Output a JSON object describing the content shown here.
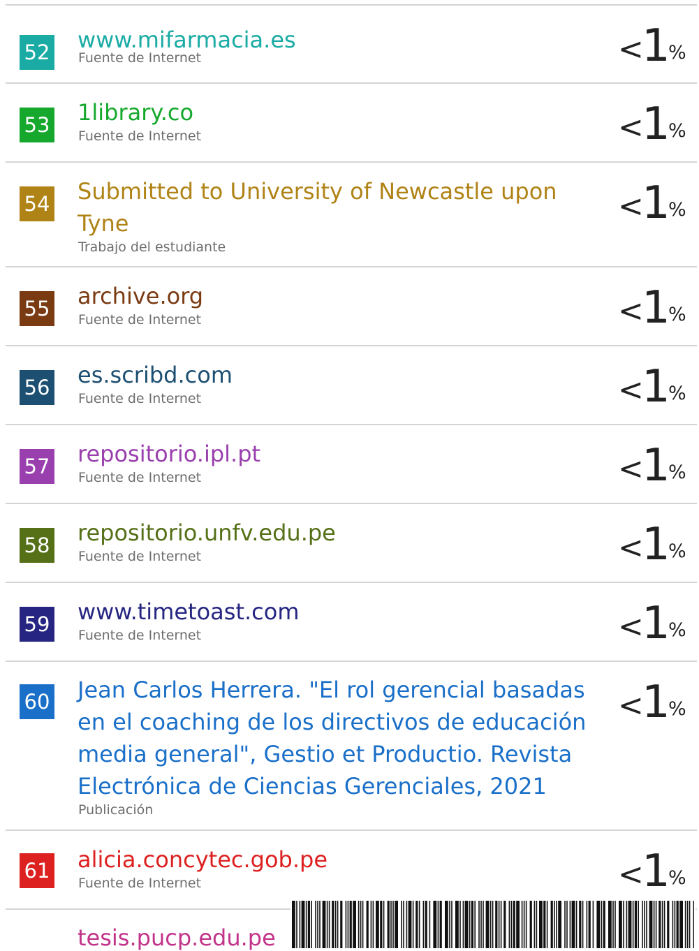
{
  "sources": [
    {
      "num": "52",
      "name": "www.mifarmacia.es",
      "type": "Fuente de Internet",
      "pct_prefix": "<",
      "pct_value": "1",
      "pct_sign": "%",
      "color": "#1aaba4"
    },
    {
      "num": "53",
      "name": "1library.co",
      "type": "Fuente de Internet",
      "pct_prefix": "<",
      "pct_value": "1",
      "pct_sign": "%",
      "color": "#16a82c"
    },
    {
      "num": "54",
      "name": "Submitted to University of Newcastle upon Tyne",
      "type": "Trabajo del estudiante",
      "pct_prefix": "<",
      "pct_value": "1",
      "pct_sign": "%",
      "color": "#b08316"
    },
    {
      "num": "55",
      "name": "archive.org",
      "type": "Fuente de Internet",
      "pct_prefix": "<",
      "pct_value": "1",
      "pct_sign": "%",
      "color": "#7a3a12"
    },
    {
      "num": "56",
      "name": "es.scribd.com",
      "type": "Fuente de Internet",
      "pct_prefix": "<",
      "pct_value": "1",
      "pct_sign": "%",
      "color": "#1d4f72"
    },
    {
      "num": "57",
      "name": "repositorio.ipl.pt",
      "type": "Fuente de Internet",
      "pct_prefix": "<",
      "pct_value": "1",
      "pct_sign": "%",
      "color": "#9a3fae"
    },
    {
      "num": "58",
      "name": "repositorio.unfv.edu.pe",
      "type": "Fuente de Internet",
      "pct_prefix": "<",
      "pct_value": "1",
      "pct_sign": "%",
      "color": "#567018"
    },
    {
      "num": "59",
      "name": "www.timetoast.com",
      "type": "Fuente de Internet",
      "pct_prefix": "<",
      "pct_value": "1",
      "pct_sign": "%",
      "color": "#262682"
    },
    {
      "num": "60",
      "name": "Jean Carlos Herrera. \"El rol gerencial basadas en el coaching de los directivos de educación media general\", Gestio et Productio. Revista Electrónica de Ciencias Gerenciales, 2021",
      "type": "Publicación",
      "pct_prefix": "<",
      "pct_value": "1",
      "pct_sign": "%",
      "color": "#1a6fc8"
    },
    {
      "num": "61",
      "name": "alicia.concytec.gob.pe",
      "type": "Fuente de Internet",
      "pct_prefix": "<",
      "pct_value": "1",
      "pct_sign": "%",
      "color": "#dd2020"
    }
  ],
  "partial_source": {
    "name": "tesis.pucp.edu.pe",
    "color": "#c2338a"
  }
}
